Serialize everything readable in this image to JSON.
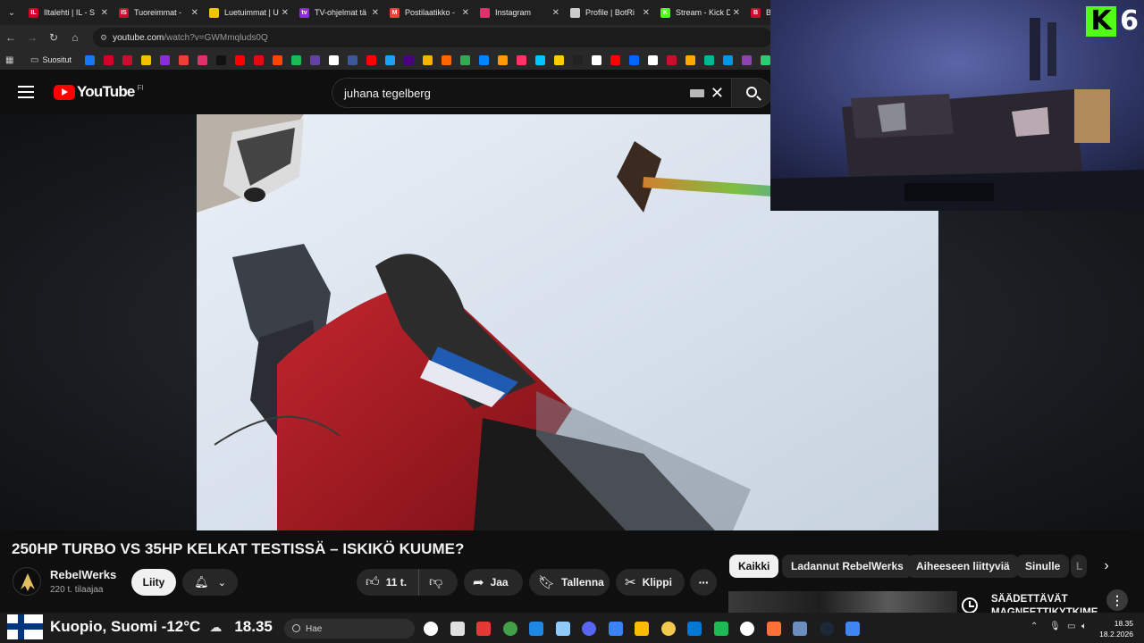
{
  "browser": {
    "tabs": [
      {
        "label": "Iltalehti | IL - S",
        "favicon": "iltalehti-icon",
        "color": "#d4002a",
        "glyph": "IL"
      },
      {
        "label": "Tuoreimmat - ",
        "favicon": "is-icon",
        "color": "#c8102e",
        "glyph": "IS"
      },
      {
        "label": "Luetuimmat | U",
        "favicon": "hexagon-icon",
        "color": "#f2c200",
        "glyph": ""
      },
      {
        "label": "TV-ohjelmat tä",
        "favicon": "tv-icon",
        "color": "#8a2be2",
        "glyph": "tv"
      },
      {
        "label": "Postilaatikko - ",
        "favicon": "gmail-icon",
        "color": "#ea4335",
        "glyph": "M"
      },
      {
        "label": "Instagram",
        "favicon": "instagram-icon",
        "color": "#e1306c",
        "glyph": ""
      },
      {
        "label": "Profile | BotRi",
        "favicon": "botrix-icon",
        "color": "#cccccc",
        "glyph": ""
      },
      {
        "label": "Stream - Kick D",
        "favicon": "kick-icon",
        "color": "#53fc18",
        "glyph": "K"
      },
      {
        "label": "Ba",
        "favicon": "ba-icon",
        "color": "#c8102e",
        "glyph": "B"
      }
    ],
    "url_host": "youtube.com",
    "url_path": "/watch?v=GWMmqluds0Q",
    "bookmarks_folder": "Suositut",
    "bookmark_colors": [
      "#1877f2",
      "#d4002a",
      "#c8102e",
      "#f2c200",
      "#8a2be2",
      "#ea4335",
      "#e1306c",
      "#111111",
      "#ff0000",
      "#e50914",
      "#ff4500",
      "#1db954",
      "#6441a5",
      "#ffffff",
      "#3b5998",
      "#ff0000",
      "#1da1f2",
      "#4b0082",
      "#f4b400",
      "#ff6600",
      "#34a853",
      "#0084ff",
      "#ff9900",
      "#ff3366",
      "#00c8ff",
      "#ffcc00",
      "#222222",
      "#ffffff",
      "#ff0000",
      "#0066ff",
      "#ffffff",
      "#c8102e",
      "#ffaa00",
      "#00b894",
      "#0097e6",
      "#8e44ad",
      "#2ecc71",
      "#a4c639"
    ]
  },
  "youtube": {
    "logo_text": "YouTube",
    "region": "FI",
    "search_value": "juhana tegelberg",
    "video_title": "250HP TURBO VS 35HP KELKAT TESTISSÄ – ISKIKÖ KUUME?",
    "channel_name": "RebelWerks",
    "subscribers": "220 t. tilaajaa",
    "join_label": "Liity",
    "like_count": "11 t.",
    "share_label": "Jaa",
    "save_label": "Tallenna",
    "clip_label": "Klippi",
    "chips": [
      "Kaikki",
      "Ladannut RebelWerks",
      "Aiheeseen liittyviä",
      "Sinulle",
      "L"
    ],
    "rec_title": "SÄÄDETTÄVÄT MAGNEETTIKYTKIME"
  },
  "overlay": {
    "kick_logo": "K",
    "kick_number": "6",
    "kick_color": "#53fc18"
  },
  "taskbar": {
    "weather_text": "Kuopio, Suomi -12°C",
    "weather_time": "18.35",
    "search_placeholder": "Hae",
    "clock_time": "18.35",
    "clock_date": "18.2.2026",
    "app_colors": [
      "#ffffff",
      "#e0e0e0",
      "#e53935",
      "#43a047",
      "#1e88e5",
      "#90caf9",
      "#5865f2",
      "#3b82f6",
      "#fbbc04",
      "#f2c94c",
      "#0078d4",
      "#1db954",
      "#ffffff",
      "#ff7139",
      "#6c8ebf",
      "#1b2838",
      "#4285f4"
    ]
  }
}
